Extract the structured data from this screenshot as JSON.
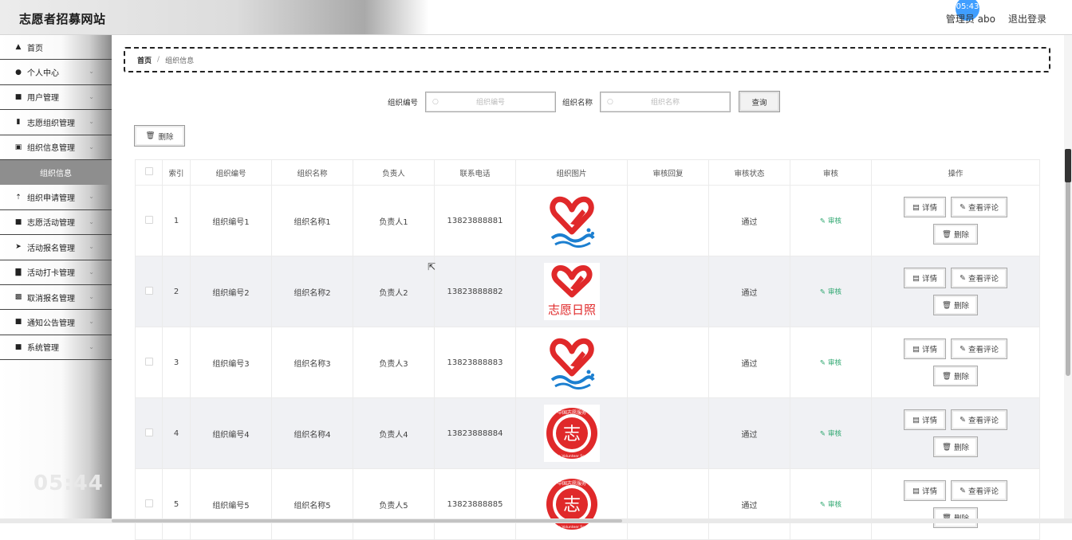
{
  "header": {
    "site_title": "志愿者招募网站",
    "role_label": "管理员",
    "username": "abo",
    "logout_label": "退出登录",
    "clock_bubble": "05:43"
  },
  "sidebar": {
    "items": [
      {
        "label": "首页",
        "icon": "home-icon",
        "glyph": "▲",
        "has_chevron": false
      },
      {
        "label": "个人中心",
        "icon": "user-icon",
        "glyph": "●",
        "has_chevron": true
      },
      {
        "label": "用户管理",
        "icon": "grid-icon",
        "glyph": "■",
        "has_chevron": true
      },
      {
        "label": "志愿组织管理",
        "icon": "book-icon",
        "glyph": "▮",
        "has_chevron": true
      },
      {
        "label": "组织信息管理",
        "icon": "clipboard-icon",
        "glyph": "▣",
        "has_chevron": true
      },
      {
        "label": "组织信息",
        "active": true
      },
      {
        "label": "组织申请管理",
        "icon": "upload-icon",
        "glyph": "⇡",
        "has_chevron": true
      },
      {
        "label": "志愿活动管理",
        "icon": "grid-icon",
        "glyph": "■",
        "has_chevron": true
      },
      {
        "label": "活动报名管理",
        "icon": "paper-plane-icon",
        "glyph": "➤",
        "has_chevron": true
      },
      {
        "label": "活动打卡管理",
        "icon": "bar-chart-icon",
        "glyph": "▇",
        "has_chevron": true
      },
      {
        "label": "取消报名管理",
        "icon": "edit-square-icon",
        "glyph": "▩",
        "has_chevron": true
      },
      {
        "label": "通知公告管理",
        "icon": "grid-icon",
        "glyph": "■",
        "has_chevron": true
      },
      {
        "label": "系统管理",
        "icon": "grid-icon",
        "glyph": "■",
        "has_chevron": true
      }
    ],
    "clock": "05:44"
  },
  "breadcrumb": {
    "home": "首页",
    "separator": "/",
    "current": "组织信息"
  },
  "search": {
    "field1_label": "组织编号",
    "field1_placeholder": "组织编号",
    "field2_label": "组织名称",
    "field2_placeholder": "组织名称",
    "query_label": "查询"
  },
  "toolbar": {
    "delete_label": "删除"
  },
  "table": {
    "columns": [
      "索引",
      "组织编号",
      "组织名称",
      "负责人",
      "联系电话",
      "组织图片",
      "审核回复",
      "审核状态",
      "审核",
      "操作"
    ],
    "rows": [
      {
        "index": "1",
        "org_no": "组织编号1",
        "org_name": "组织名称1",
        "leader": "负责人1",
        "phone": "13823888881",
        "logo": "heart-hand",
        "reply": "",
        "status": "通过",
        "audit": "审核"
      },
      {
        "index": "2",
        "org_no": "组织编号2",
        "org_name": "组织名称2",
        "leader": "负责人2",
        "phone": "13823888882",
        "logo": "heart-text",
        "reply": "",
        "status": "通过",
        "audit": "审核"
      },
      {
        "index": "3",
        "org_no": "组织编号3",
        "org_name": "组织名称3",
        "leader": "负责人3",
        "phone": "13823888883",
        "logo": "heart-hand",
        "reply": "",
        "status": "通过",
        "audit": "审核"
      },
      {
        "index": "4",
        "org_no": "组织编号4",
        "org_name": "组织名称4",
        "leader": "负责人4",
        "phone": "13823888884",
        "logo": "seal",
        "reply": "",
        "status": "通过",
        "audit": "审核"
      },
      {
        "index": "5",
        "org_no": "组织编号5",
        "org_name": "组织名称5",
        "leader": "负责人5",
        "phone": "13823888885",
        "logo": "seal",
        "reply": "",
        "status": "通过",
        "audit": "审核"
      }
    ],
    "op_detail": "详情",
    "op_comment": "查看评论",
    "op_delete": "删除"
  },
  "logo_text": {
    "heart_text": "志愿日照",
    "seal_top": "中国志愿服务",
    "seal_bottom": "China Volunteer Service",
    "seal_center": "志"
  },
  "colors": {
    "logo_red": "#e0292a",
    "logo_blue": "#1b7fd0",
    "audit_green": "#2aa56d",
    "active_menu": "#8e8e8e"
  }
}
